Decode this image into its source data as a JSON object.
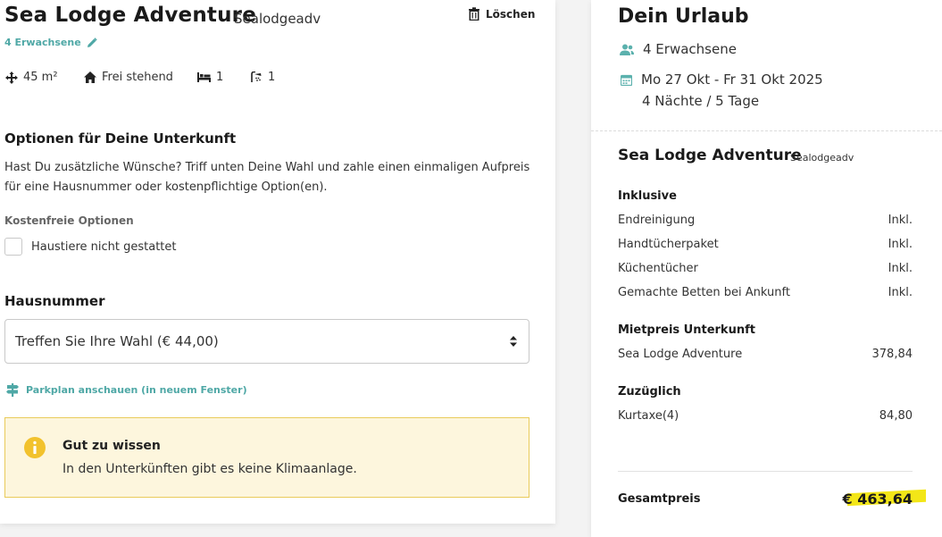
{
  "accommodation": {
    "name": "Sea Lodge Adventure",
    "code": "Sealodgeadv",
    "delete_label": "Löschen",
    "guests_link": "4 Erwachsene",
    "features": {
      "area": "45 m²",
      "type": "Frei stehend",
      "beds": "1",
      "bathrooms": "1"
    }
  },
  "options": {
    "heading": "Optionen für Deine Unterkunft",
    "description": "Hast Du zusätzliche Wünsche? Triff unten Deine Wahl und zahle einen einmaligen Aufpreis für eine Hausnummer oder kostenpflichtige Option(en).",
    "free_options_label": "Kostenfreie Optionen",
    "pets_label": "Haustiere nicht gestattet",
    "pets_checked": false
  },
  "house_number": {
    "heading": "Hausnummer",
    "select_value": "Treffen Sie Ihre Wahl (€ 44,00)",
    "parkplan_link": "Parkplan anschauen (in neuem Fenster)"
  },
  "info": {
    "title": "Gut zu wissen",
    "text": "In den Unterkünften gibt es keine Klimaanlage."
  },
  "summary": {
    "title": "Dein Urlaub",
    "guests": "4 Erwachsene",
    "dates": "Mo 27 Okt - Fr 31 Okt 2025",
    "duration": "4 Nächte / 5 Tage",
    "lodge_name": "Sea Lodge Adventure",
    "lodge_code": "Sealodgeadv",
    "inclusive_heading": "Inklusive",
    "inclusive_items": [
      {
        "label": "Endreinigung",
        "value": "Inkl."
      },
      {
        "label": "Handtücherpaket",
        "value": "Inkl."
      },
      {
        "label": "Küchentücher",
        "value": "Inkl."
      },
      {
        "label": "Gemachte Betten bei Ankunft",
        "value": "Inkl."
      }
    ],
    "rent_heading": "Mietpreis Unterkunft",
    "rent_items": [
      {
        "label": "Sea Lodge Adventure",
        "value": "378,84"
      }
    ],
    "extra_heading": "Zuzüglich",
    "extra_items": [
      {
        "label": "Kurtaxe(4)",
        "value": "84,80"
      }
    ],
    "total_label": "Gesamtpreis",
    "total_value": "€ 463,64"
  },
  "colors": {
    "accent": "#4fa8a6",
    "info_bg": "#fdf6dd",
    "info_border": "#e9cb5a",
    "info_icon": "#f2c22d",
    "highlight": "#f3e617"
  }
}
